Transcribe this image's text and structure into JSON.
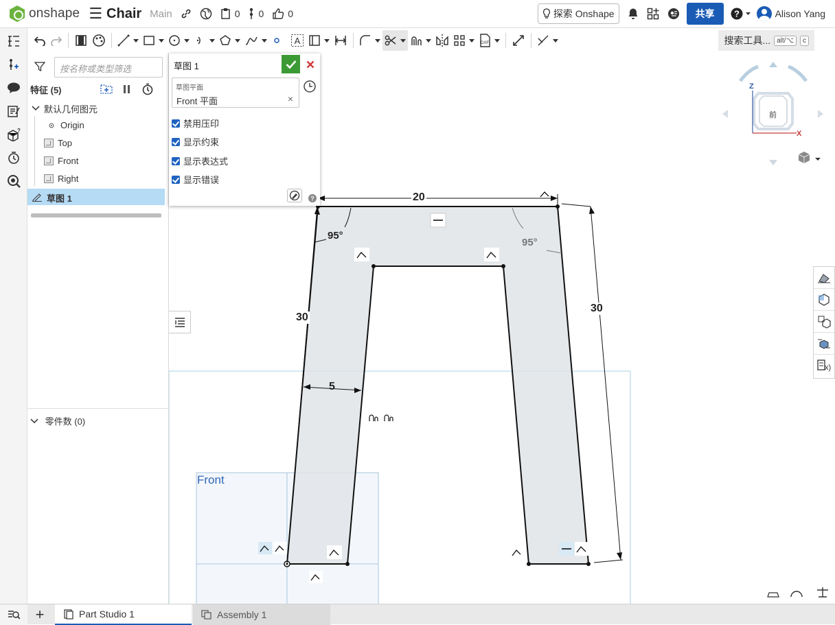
{
  "app": {
    "logo_text": "onshape",
    "doc_title": "Chair",
    "workspace": "Main",
    "version_count": "0",
    "branch_count": "0",
    "like_count": "0",
    "explore_label": "探索 Onshape",
    "share_label": "共享",
    "user_name": "Alison Yang",
    "brand_color": "#1a5bb5"
  },
  "toolbar": {
    "search_label": "搜索工具...",
    "shortcut_1": "alt/⌥",
    "shortcut_2": "c"
  },
  "feature_panel": {
    "filter_placeholder": "按名称或类型筛选",
    "features_header": "特征 (5)",
    "default_geometry": "默认几何图元",
    "items": [
      {
        "label": "Origin"
      },
      {
        "label": "Top"
      },
      {
        "label": "Front"
      },
      {
        "label": "Right"
      }
    ],
    "sketch_item": "草图 1",
    "parts_label": "零件数 (0)"
  },
  "sketch_dialog": {
    "title": "草图 1",
    "plane_caption": "草图平面",
    "plane_value": "Front 平面",
    "options": [
      {
        "label": "禁用压印",
        "checked": true
      },
      {
        "label": "显示约束",
        "checked": true
      },
      {
        "label": "显示表达式",
        "checked": true
      },
      {
        "label": "显示错误",
        "checked": true
      }
    ]
  },
  "viewport": {
    "plane_label": "Front",
    "view_cube_face": "前",
    "axis_z": "Z",
    "axis_x": "X",
    "dimensions": {
      "top_width": "20",
      "left_height": "30",
      "right_height": "30",
      "leg_width": "5",
      "angle_left": "95°",
      "angle_right": "95°"
    }
  },
  "tabs": [
    {
      "label": "Part Studio 1",
      "active": true
    },
    {
      "label": "Assembly 1",
      "active": false
    }
  ]
}
